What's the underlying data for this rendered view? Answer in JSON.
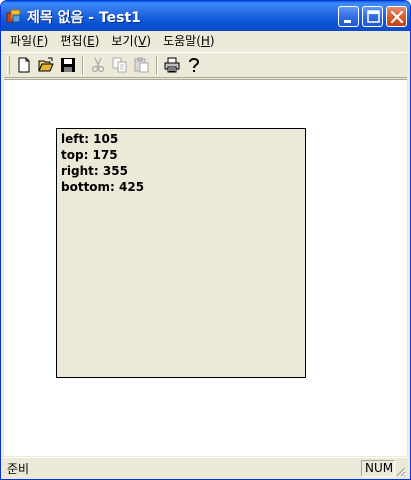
{
  "window": {
    "title": "제목 없음 - Test1",
    "colors": {
      "titlebar": "#0a55d6",
      "frame": "#ece9d8",
      "close": "#c3431a"
    }
  },
  "titlebar_buttons": [
    {
      "name": "minimize-button",
      "icon": "minimize-icon"
    },
    {
      "name": "maximize-button",
      "icon": "maximize-icon"
    },
    {
      "name": "close-button",
      "icon": "close-icon"
    }
  ],
  "menu": {
    "items": [
      {
        "label": "파일(",
        "mnemonic": "F",
        "suffix": ")"
      },
      {
        "label": "편집(",
        "mnemonic": "E",
        "suffix": ")"
      },
      {
        "label": "보기(",
        "mnemonic": "V",
        "suffix": ")"
      },
      {
        "label": "도움말(",
        "mnemonic": "H",
        "suffix": ")"
      }
    ]
  },
  "toolbar": {
    "buttons": [
      {
        "icon": "new-file-icon",
        "enabled": true
      },
      {
        "icon": "open-folder-icon",
        "enabled": true
      },
      {
        "icon": "save-icon",
        "enabled": true
      },
      {
        "icon": "cut-icon",
        "enabled": false
      },
      {
        "icon": "copy-icon",
        "enabled": false
      },
      {
        "icon": "paste-icon",
        "enabled": false
      },
      {
        "icon": "print-icon",
        "enabled": true
      },
      {
        "icon": "help-icon",
        "enabled": true
      }
    ]
  },
  "rect_info": {
    "lines": [
      "left: 105",
      "top: 175",
      "right: 355",
      "bottom: 425"
    ]
  },
  "status": {
    "text": "준비",
    "indicator": "NUM"
  }
}
